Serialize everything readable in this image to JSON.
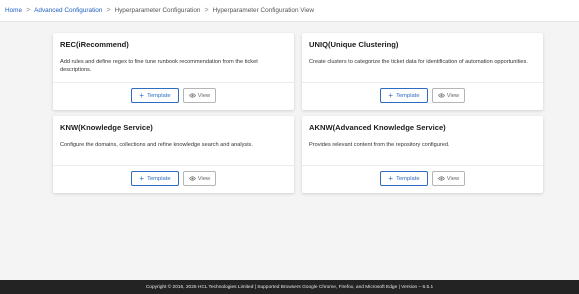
{
  "breadcrumb": {
    "items": [
      {
        "label": "Home"
      },
      {
        "label": "Advanced Configuration"
      },
      {
        "label": "Hyperparameter Configuration"
      },
      {
        "label": "Hyperparameter Configuration View"
      }
    ],
    "separator": ">"
  },
  "cards": [
    {
      "title": "REC(iRecommend)",
      "description": "Add rules and define regex to fine tune runbook recommendation from the ticket descriptions.",
      "template_label": "Template",
      "view_label": "View"
    },
    {
      "title": "UNIQ(Unique Clustering)",
      "description": "Create clusters to categorize the ticket data for identification of automation opportunities.",
      "template_label": "Template",
      "view_label": "View"
    },
    {
      "title": "KNW(Knowledge Service)",
      "description": "Configure the domains, collections and refine knowledge search and analysis.",
      "template_label": "Template",
      "view_label": "View"
    },
    {
      "title": "AKNW(Advanced Knowledge Service)",
      "description": "Provides relevant content from the repository configured.",
      "template_label": "Template",
      "view_label": "View"
    }
  ],
  "icons": {
    "template": "plus-icon",
    "view": "eye-icon"
  },
  "colors": {
    "link": "#1f5fbf",
    "template_button": "#2d6cc0",
    "footer_bg": "#232323"
  },
  "footer": {
    "text": "Copyright © 2016, 2025 HCL Technologies Limited | Supported Browsers Google Chrome, Firefox, and Microsoft Edge | Version – 6.5.1"
  }
}
